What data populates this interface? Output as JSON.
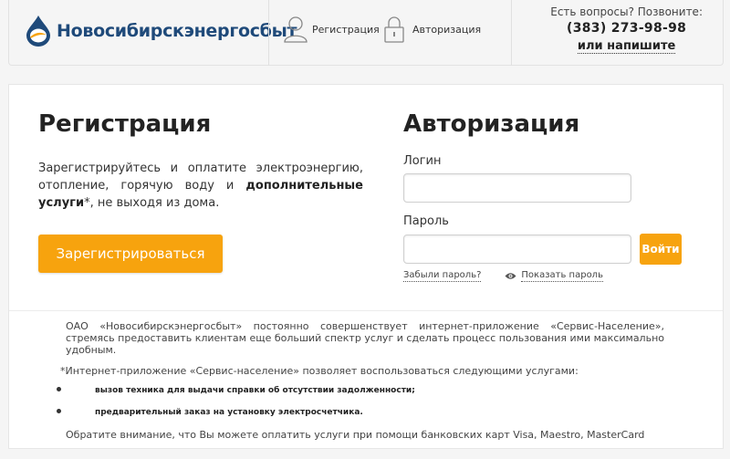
{
  "header": {
    "logo_text": "Новосибирскэнергосбыт",
    "nav": [
      {
        "label": "Регистрация",
        "icon": "user-icon"
      },
      {
        "label": "Авторизация",
        "icon": "lock-icon"
      }
    ],
    "contact": {
      "question": "Есть вопросы? Позвоните:",
      "phone": "(383) 273-98-98",
      "write_link": "или напишите"
    }
  },
  "registration": {
    "title": "Регистрация",
    "desc_part1": "Зарегистрируйтесь и оплатите электроэнергию, отопление, горячую воду и ",
    "desc_bold": "дополнительные услуги",
    "desc_part2": "*, не выходя из дома.",
    "button": "Зарегистрироваться"
  },
  "auth": {
    "title": "Авторизация",
    "login_label": "Логин",
    "login_value": "",
    "password_label": "Пароль",
    "password_value": "",
    "submit": "Войти",
    "forgot_link": "Забыли пароль?",
    "show_password": "Показать пароль"
  },
  "footer": {
    "intro": "ОАО «Новосибирскэнергосбыт» постоянно совершенствует интернет-приложение «Сервис-Население», стремясь предоставить клиентам еще больший спектр услуг и сделать процесс пользования ими максимально удобным.",
    "note": "*Интернет-приложение «Сервис-население» позволяет воспользоваться следующими услугами:",
    "services": [
      "вызов техника для выдачи справки об отсутствии задолженности;",
      "предварительный заказ на установку электросчетчика."
    ],
    "payment": "Обратите внимание, что Вы можете оплатить услуги при помощи банковских карт Visa, Maestro, MasterCard"
  },
  "colors": {
    "accent": "#f7a30e",
    "brand": "#1f4a7a"
  }
}
